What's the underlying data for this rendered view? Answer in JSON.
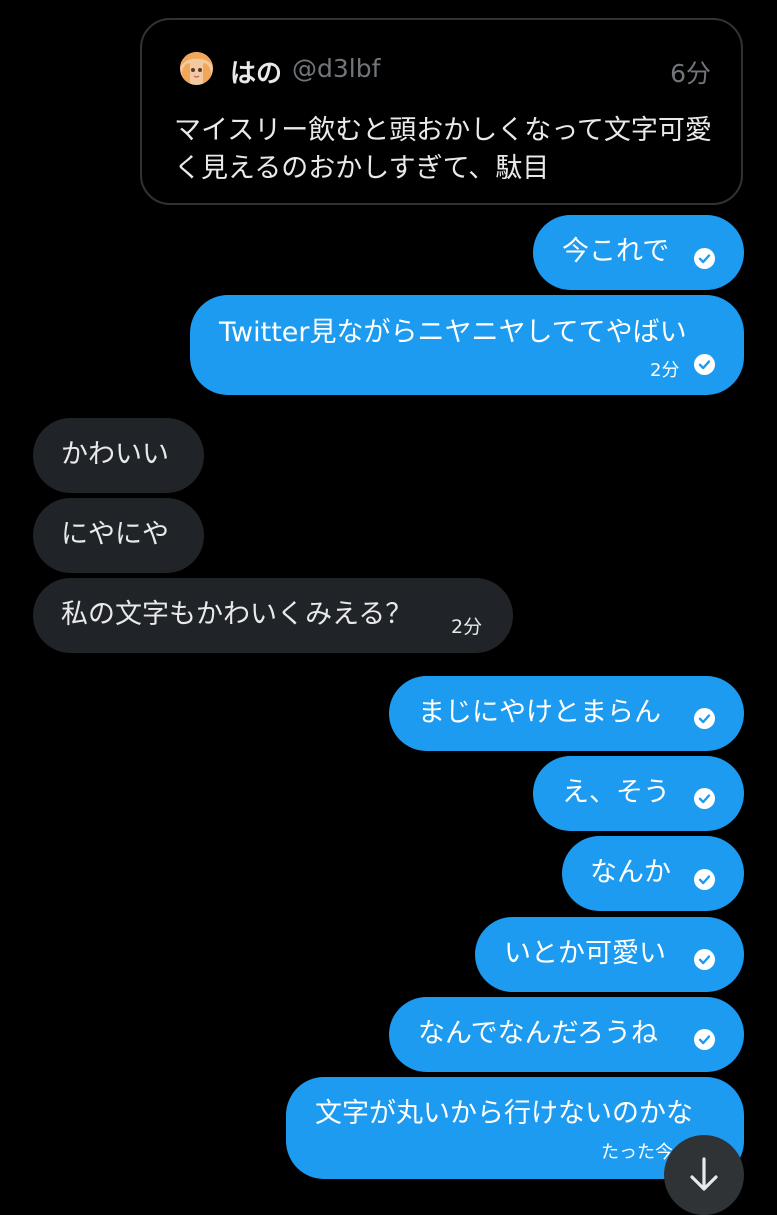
{
  "quote": {
    "name": "はの",
    "handle": "@d3lbf",
    "time": "6分",
    "text": "マイスリー飲むと頭おかしくなって文字可愛く見えるのおかしすぎて、駄目"
  },
  "messages": [
    {
      "side": "out",
      "text": "今これで",
      "time": ""
    },
    {
      "side": "out",
      "text": "Twitter見ながらニヤニヤしててやばい",
      "time": "2分"
    },
    {
      "side": "in",
      "text": "かわいい",
      "time": ""
    },
    {
      "side": "in",
      "text": "にやにや",
      "time": ""
    },
    {
      "side": "in",
      "text": "私の文字もかわいくみえる？",
      "time": "2分"
    },
    {
      "side": "out",
      "text": "まじにやけとまらん",
      "time": ""
    },
    {
      "side": "out",
      "text": "え、そう",
      "time": ""
    },
    {
      "side": "out",
      "text": "なんか",
      "time": ""
    },
    {
      "side": "out",
      "text": "いとか可愛い",
      "time": ""
    },
    {
      "side": "out",
      "text": "なんでなんだろうね",
      "time": ""
    },
    {
      "side": "out",
      "text": "文字が丸いから行けないのかな",
      "time": "たった今"
    }
  ],
  "colors": {
    "background": "#000000",
    "outgoing_bubble": "#1d9bf0",
    "incoming_bubble": "#202327",
    "muted_text": "#71767b",
    "quote_border": "#2f3336"
  },
  "icons": {
    "read_receipt": "check-circle-icon",
    "scroll_down": "arrow-down-icon"
  }
}
